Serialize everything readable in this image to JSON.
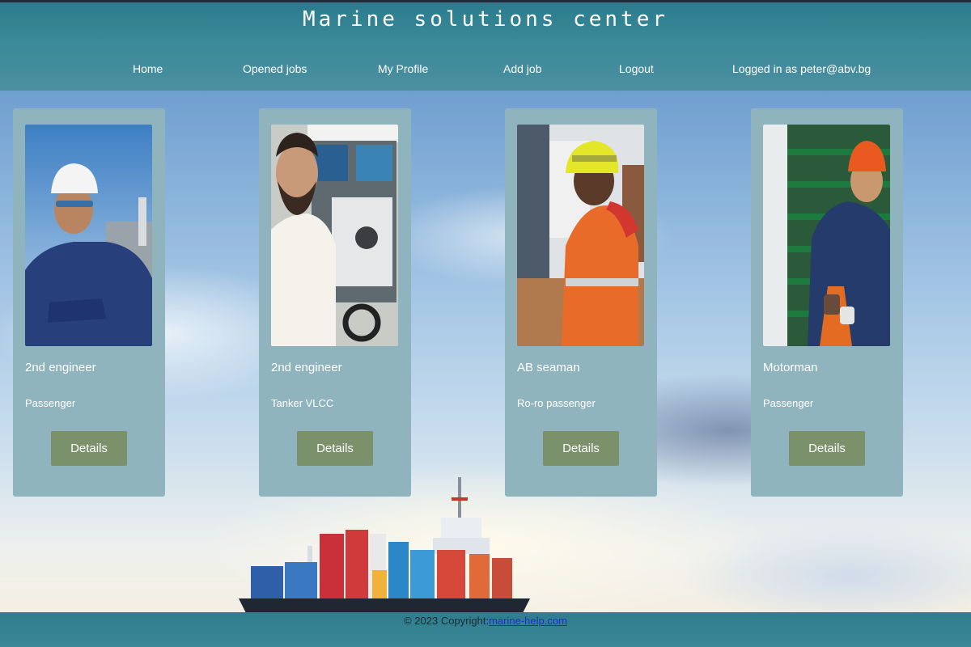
{
  "header": {
    "title": "Marine solutions center"
  },
  "nav": {
    "home": "Home",
    "opened_jobs": "Opened jobs",
    "my_profile": "My Profile",
    "add_job": "Add job",
    "logout": "Logout",
    "logged_in": "Logged in as peter@abv.bg"
  },
  "cards": [
    {
      "title": "2nd engineer",
      "type": "Passenger",
      "button": "Details"
    },
    {
      "title": "2nd engineer",
      "type": "Tanker VLCC",
      "button": "Details"
    },
    {
      "title": "AB seaman",
      "type": "Ro-ro passenger",
      "button": "Details"
    },
    {
      "title": "Motorman",
      "type": "Passenger",
      "button": "Details"
    }
  ],
  "footer": {
    "copyright": "© 2023 Copyright:",
    "link": "marine-help.com"
  },
  "colors": {
    "header": "#3a8a99",
    "card": "#8fb4bd",
    "button": "#7a916b"
  }
}
